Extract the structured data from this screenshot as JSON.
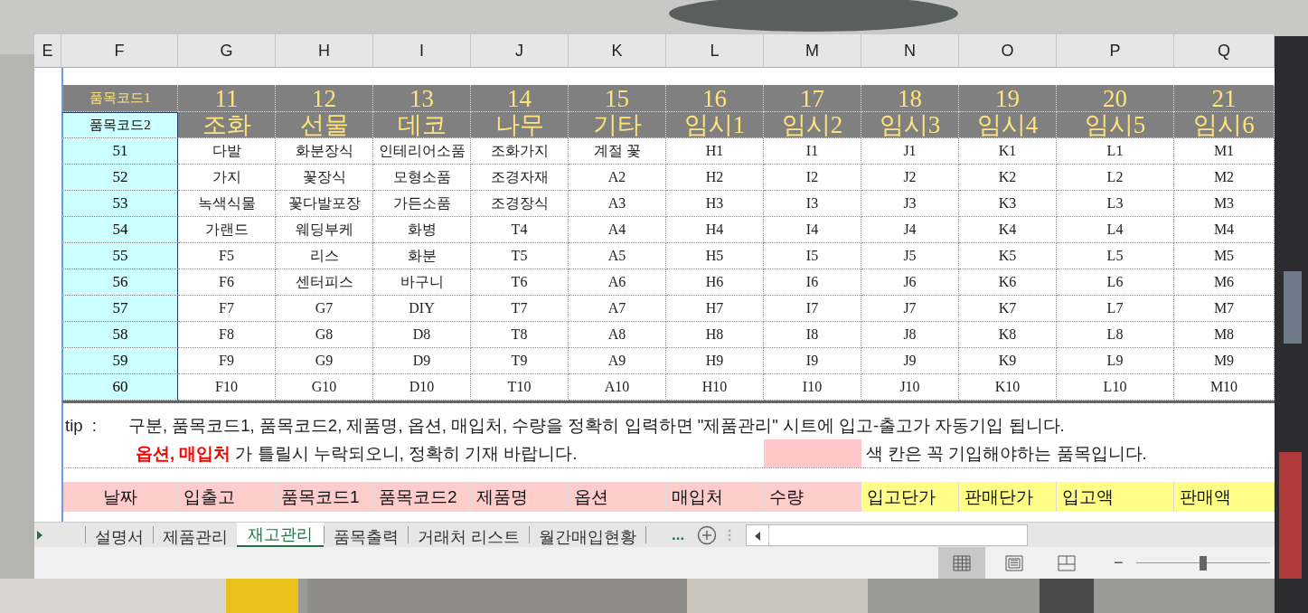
{
  "column_letters": [
    "E",
    "F",
    "G",
    "H",
    "I",
    "J",
    "K",
    "L",
    "M",
    "N",
    "O",
    "P",
    "Q"
  ],
  "code1_row": {
    "label": "품목코드1",
    "values": [
      "11",
      "12",
      "13",
      "14",
      "15",
      "16",
      "17",
      "18",
      "19",
      "20",
      "21"
    ]
  },
  "code2_row": {
    "label": "품목코드2",
    "values": [
      "조화",
      "선물",
      "데코",
      "나무",
      "기타",
      "임시1",
      "임시2",
      "임시3",
      "임시4",
      "임시5",
      "임시6"
    ]
  },
  "rows": [
    {
      "code": "51",
      "cells": [
        "다발",
        "화분장식",
        "인테리어소품",
        "조화가지",
        "계절 꽃",
        "H1",
        "I1",
        "J1",
        "K1",
        "L1",
        "M1"
      ]
    },
    {
      "code": "52",
      "cells": [
        "가지",
        "꽃장식",
        "모형소품",
        "조경자재",
        "A2",
        "H2",
        "I2",
        "J2",
        "K2",
        "L2",
        "M2"
      ]
    },
    {
      "code": "53",
      "cells": [
        "녹색식물",
        "꽃다발포장",
        "가든소품",
        "조경장식",
        "A3",
        "H3",
        "I3",
        "J3",
        "K3",
        "L3",
        "M3"
      ]
    },
    {
      "code": "54",
      "cells": [
        "가랜드",
        "웨딩부케",
        "화병",
        "T4",
        "A4",
        "H4",
        "I4",
        "J4",
        "K4",
        "L4",
        "M4"
      ]
    },
    {
      "code": "55",
      "cells": [
        "F5",
        "리스",
        "화분",
        "T5",
        "A5",
        "H5",
        "I5",
        "J5",
        "K5",
        "L5",
        "M5"
      ]
    },
    {
      "code": "56",
      "cells": [
        "F6",
        "센터피스",
        "바구니",
        "T6",
        "A6",
        "H6",
        "I6",
        "J6",
        "K6",
        "L6",
        "M6"
      ]
    },
    {
      "code": "57",
      "cells": [
        "F7",
        "G7",
        "DIY",
        "T7",
        "A7",
        "H7",
        "I7",
        "J7",
        "K7",
        "L7",
        "M7"
      ]
    },
    {
      "code": "58",
      "cells": [
        "F8",
        "G8",
        "D8",
        "T8",
        "A8",
        "H8",
        "I8",
        "J8",
        "K8",
        "L8",
        "M8"
      ]
    },
    {
      "code": "59",
      "cells": [
        "F9",
        "G9",
        "D9",
        "T9",
        "A9",
        "H9",
        "I9",
        "J9",
        "K9",
        "L9",
        "M9"
      ]
    },
    {
      "code": "60",
      "cells": [
        "F10",
        "G10",
        "D10",
        "T10",
        "A10",
        "H10",
        "I10",
        "J10",
        "K10",
        "L10",
        "M10"
      ]
    }
  ],
  "tip": {
    "label": "tip  :",
    "line1": "구분, 품목코드1, 품목코드2, 제품명, 옵션, 매입처, 수량을 정확히 입력하면 \"제품관리\" 시트에 입고-출고가 자동기입 됩니다.",
    "line2": "**옵션, 매입처** 가 틀릴시 누락되오니, 정확히 기재 바랍니다.",
    "legend": "색 칸은 꼭 기입해야하는 품목입니다."
  },
  "entry_headers": [
    {
      "label": "날짜",
      "required": true
    },
    {
      "label": "입출고",
      "required": true
    },
    {
      "label": "품목코드1",
      "required": true
    },
    {
      "label": "품목코드2",
      "required": true
    },
    {
      "label": "제품명",
      "required": true
    },
    {
      "label": "옵션",
      "required": true
    },
    {
      "label": "매입처",
      "required": true
    },
    {
      "label": "수량",
      "required": true
    },
    {
      "label": "입고단가",
      "required": false
    },
    {
      "label": "판매단가",
      "required": false
    },
    {
      "label": "입고액",
      "required": false
    },
    {
      "label": "판매액",
      "required": false
    }
  ],
  "sheet_tabs": [
    {
      "label": "설명서",
      "selected": false
    },
    {
      "label": "제품관리",
      "selected": false
    },
    {
      "label": "재고관리",
      "selected": true
    },
    {
      "label": "품목출력",
      "selected": false
    },
    {
      "label": "거래처 리스트",
      "selected": false
    },
    {
      "label": "월간매입현황",
      "selected": false
    }
  ],
  "more_tabs": "...",
  "views": [
    {
      "kind": "normal",
      "selected": true
    },
    {
      "kind": "page-layout",
      "selected": false
    },
    {
      "kind": "page-break",
      "selected": false
    }
  ],
  "zoom": {
    "minus": "−",
    "level": 0.5
  }
}
